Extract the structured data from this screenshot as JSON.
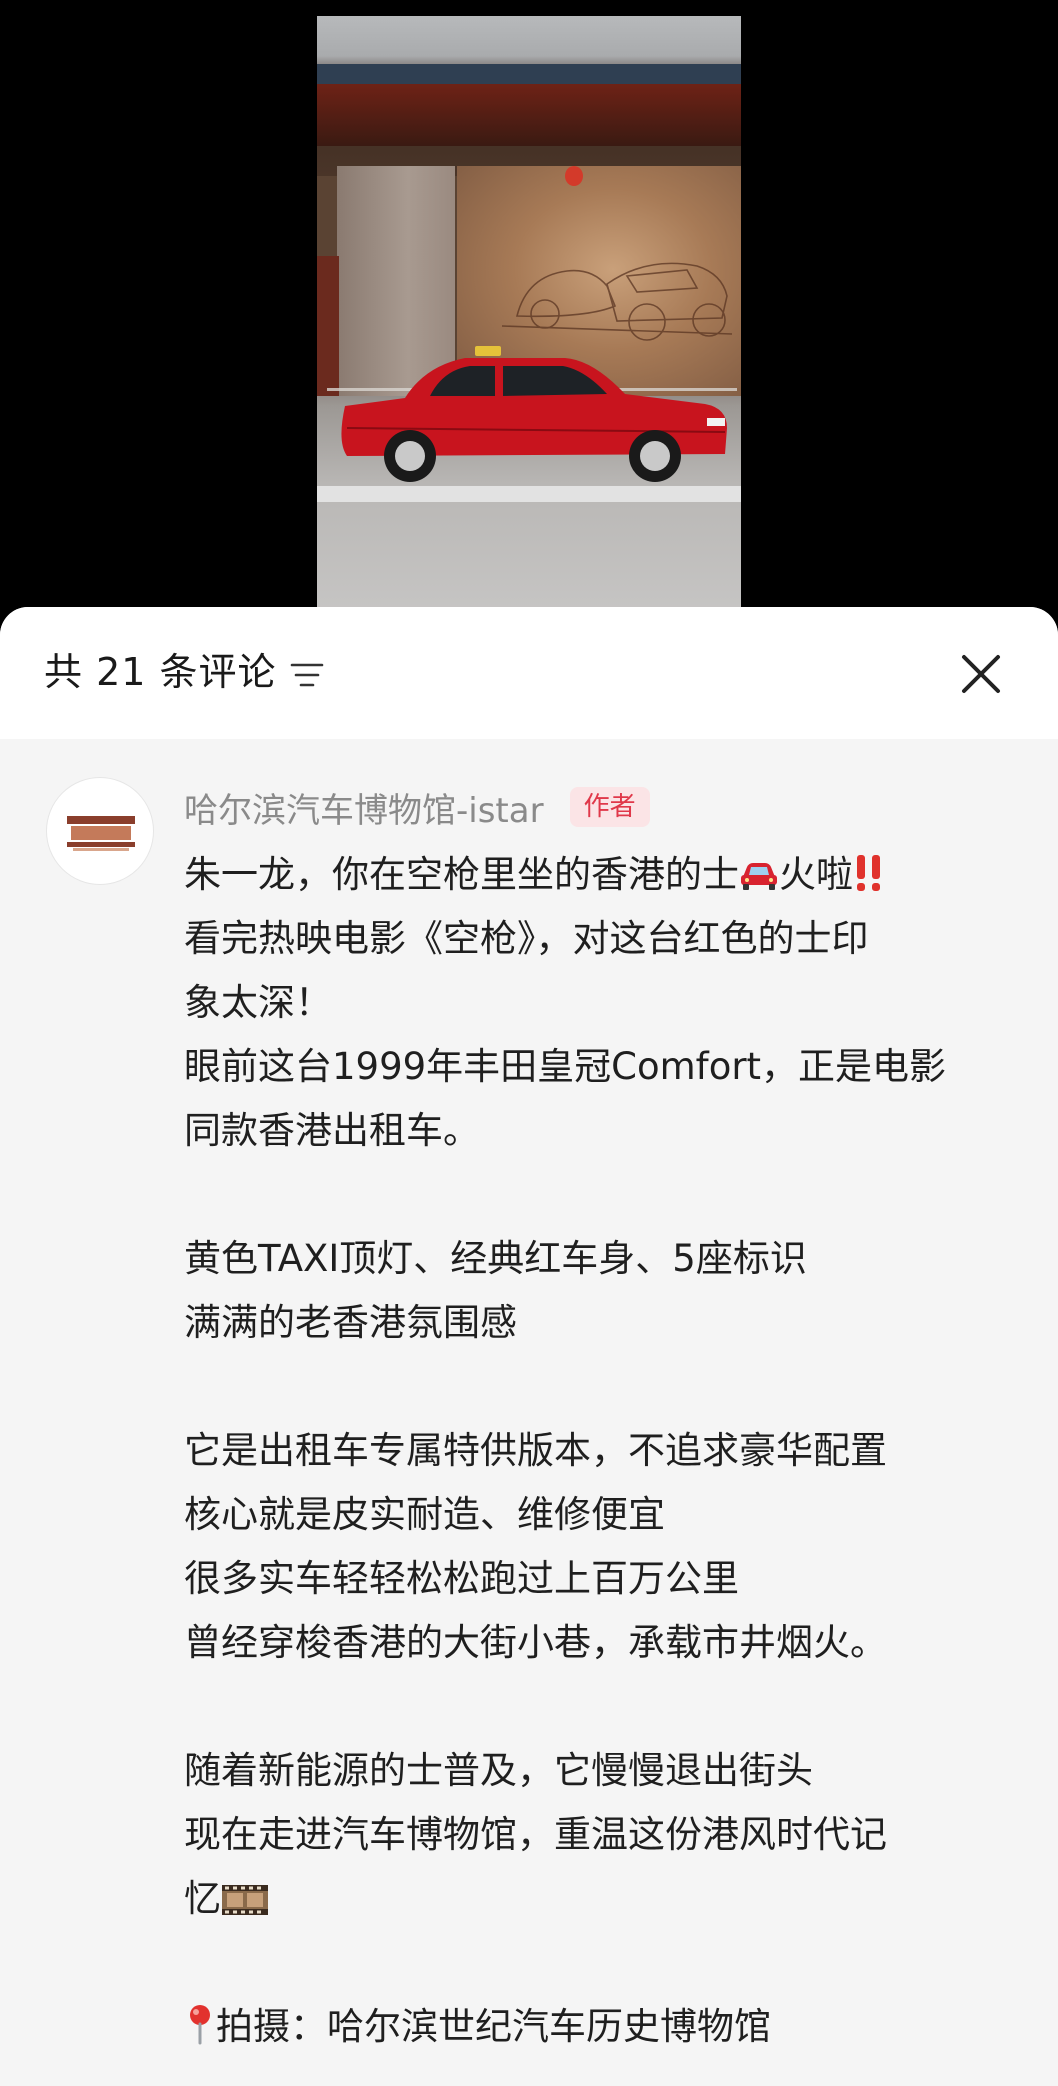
{
  "sheet": {
    "count_text": "共 21 条评论",
    "sort_icon": "sort-lines-icon",
    "close_icon": "close-x-icon"
  },
  "comment": {
    "author_name": "哈尔滨汽车博物馆-istar",
    "author_tag": "作者",
    "lines": [
      "朱一龙，你在空枪里坐的香港的士",
      "火啦",
      "看完热映电影《空枪》，对这台红色的士印",
      "象太深！",
      "眼前这台1999年丰田皇冠Comfort，正是电影",
      "同款香港出租车。",
      "",
      "黄色TAXI顶灯、经典红车身、5座标识",
      "满满的老香港氛围感",
      "",
      "它是出租车专属特供版本，不追求豪华配置",
      "核心就是皮实耐造、维修便宜",
      "很多实车轻轻松松跑过上百万公里",
      "曾经穿梭香港的大街小巷，承载市井烟火。",
      "",
      "随着新能源的士普及，它慢慢退出街头",
      "现在走进汽车博物馆，重温这份港风时代记",
      "忆",
      "",
      "拍摄：哈尔滨世纪汽车历史博物馆"
    ],
    "icons": {
      "taxi_emoji": "red-car-emoji-icon",
      "exclamation_emoji": "double-exclamation-icon",
      "film_emoji": "film-strip-icon",
      "pin_emoji": "round-pushpin-icon"
    }
  },
  "colors": {
    "author_tag_text": "#e0384a",
    "author_tag_bg": "#fbe4e6",
    "sheet_bg": "#f5f5f5"
  }
}
